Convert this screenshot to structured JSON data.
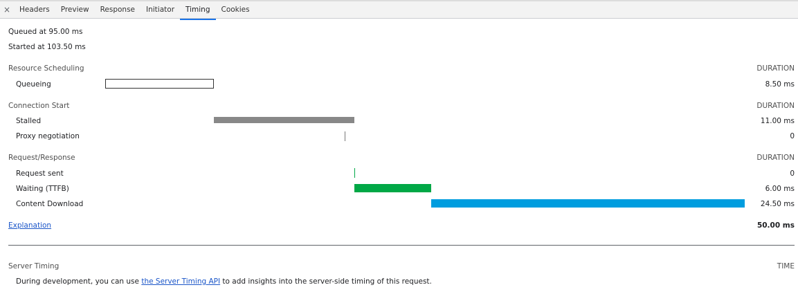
{
  "tabs": {
    "close": "×",
    "items": [
      "Headers",
      "Preview",
      "Response",
      "Initiator",
      "Timing",
      "Cookies"
    ],
    "active_index": 4
  },
  "queued_at": "Queued at 95.00 ms",
  "started_at": "Started at 103.50 ms",
  "sections": {
    "scheduling": {
      "title": "Resource Scheduling",
      "duration_header": "DURATION",
      "rows": [
        {
          "label": "Queueing",
          "duration": "8.50 ms"
        }
      ]
    },
    "connection": {
      "title": "Connection Start",
      "duration_header": "DURATION",
      "rows": [
        {
          "label": "Stalled",
          "duration": "11.00 ms"
        },
        {
          "label": "Proxy negotiation",
          "duration": "0"
        }
      ]
    },
    "request": {
      "title": "Request/Response",
      "duration_header": "DURATION",
      "rows": [
        {
          "label": "Request sent",
          "duration": "0"
        },
        {
          "label": "Waiting (TTFB)",
          "duration": "6.00 ms"
        },
        {
          "label": "Content Download",
          "duration": "24.50 ms"
        }
      ]
    }
  },
  "timeline": {
    "total_ms": 50.0,
    "phases": [
      {
        "name": "queueing",
        "start_ms": 0.0,
        "duration_ms": 8.5,
        "color": "#ffffff"
      },
      {
        "name": "stalled",
        "start_ms": 8.5,
        "duration_ms": 11.0,
        "color": "#888888"
      },
      {
        "name": "proxy",
        "start_ms": 18.7,
        "duration_ms": 0,
        "color": "#777777"
      },
      {
        "name": "request-sent",
        "start_ms": 19.5,
        "duration_ms": 0,
        "color": "#00a846"
      },
      {
        "name": "ttfb",
        "start_ms": 19.5,
        "duration_ms": 6.0,
        "color": "#00a846"
      },
      {
        "name": "download",
        "start_ms": 25.5,
        "duration_ms": 24.5,
        "color": "#009ddf"
      }
    ]
  },
  "explanation_link": "Explanation",
  "total_duration": "50.00 ms",
  "server_timing": {
    "title": "Server Timing",
    "header": "TIME",
    "text_before": "During development, you can use ",
    "link": "the Server Timing API",
    "text_after": " to add insights into the server-side timing of this request."
  }
}
